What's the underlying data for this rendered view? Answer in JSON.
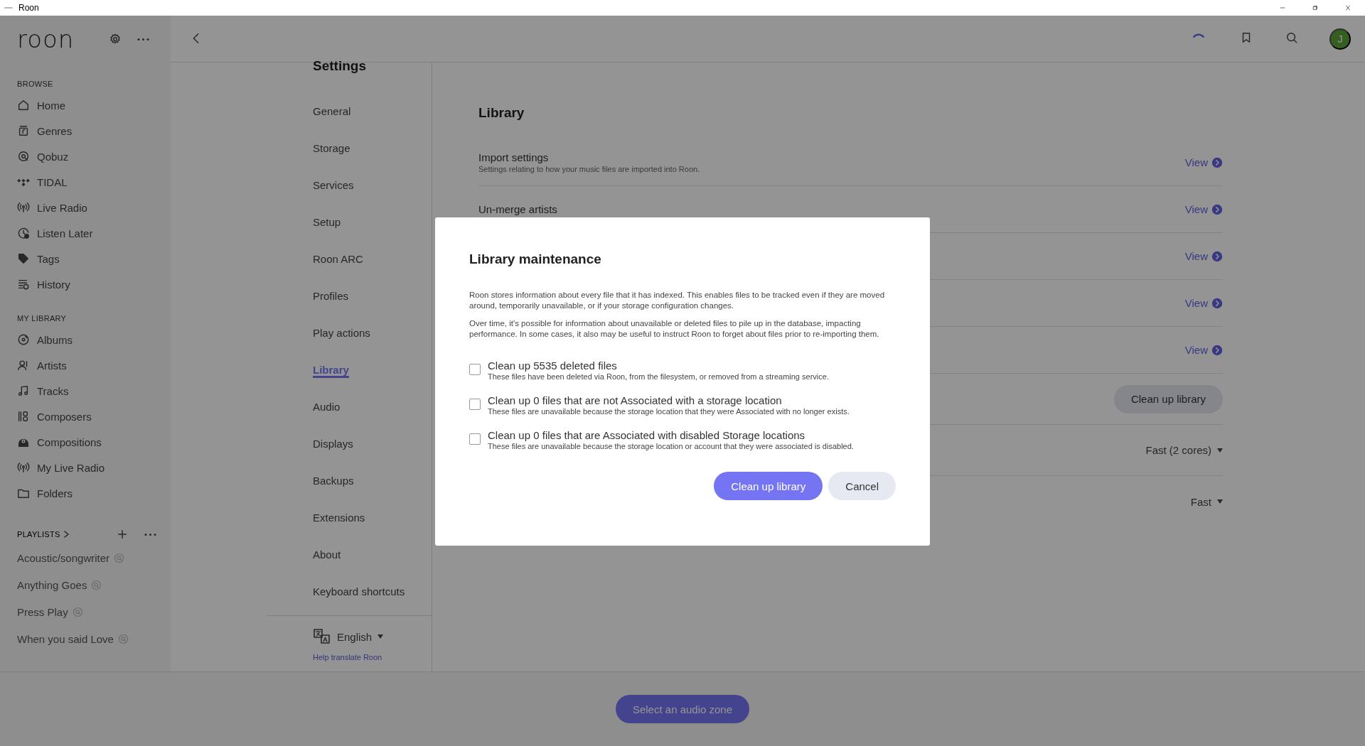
{
  "window": {
    "title": "Roon"
  },
  "sidebar": {
    "logo": "roon",
    "sections": [
      {
        "heading": "BROWSE",
        "items": [
          {
            "label": "Home"
          },
          {
            "label": "Genres"
          },
          {
            "label": "Qobuz"
          },
          {
            "label": "TIDAL"
          },
          {
            "label": "Live Radio"
          },
          {
            "label": "Listen Later"
          },
          {
            "label": "Tags"
          },
          {
            "label": "History"
          }
        ]
      },
      {
        "heading": "MY LIBRARY",
        "items": [
          {
            "label": "Albums"
          },
          {
            "label": "Artists"
          },
          {
            "label": "Tracks"
          },
          {
            "label": "Composers"
          },
          {
            "label": "Compositions"
          },
          {
            "label": "My Live Radio"
          },
          {
            "label": "Folders"
          }
        ]
      }
    ],
    "playlists": {
      "heading": "PLAYLISTS",
      "items": [
        {
          "label": "Acoustic/songwriter"
        },
        {
          "label": "Anything Goes"
        },
        {
          "label": "Press Play"
        },
        {
          "label": "When you said Love"
        }
      ]
    }
  },
  "header": {
    "avatar": "J"
  },
  "settings_nav": {
    "title": "Settings",
    "items": [
      {
        "label": "General",
        "selected": false
      },
      {
        "label": "Storage",
        "selected": false
      },
      {
        "label": "Services",
        "selected": false
      },
      {
        "label": "Setup",
        "selected": false
      },
      {
        "label": "Roon ARC",
        "selected": false
      },
      {
        "label": "Profiles",
        "selected": false
      },
      {
        "label": "Play actions",
        "selected": false
      },
      {
        "label": "Library",
        "selected": true
      },
      {
        "label": "Audio",
        "selected": false
      },
      {
        "label": "Displays",
        "selected": false
      },
      {
        "label": "Backups",
        "selected": false
      },
      {
        "label": "Extensions",
        "selected": false
      },
      {
        "label": "About",
        "selected": false
      },
      {
        "label": "Keyboard shortcuts",
        "selected": false
      }
    ],
    "language": "English",
    "help_link": "Help translate Roon"
  },
  "library": {
    "title": "Library",
    "rows": [
      {
        "kind": "view",
        "label": "Import settings",
        "description": "Settings relating to how your music files are imported into Roon.",
        "action": "View"
      },
      {
        "kind": "view",
        "label": "Un-merge artists",
        "action": "View"
      },
      {
        "kind": "view",
        "action": "View"
      },
      {
        "kind": "view",
        "action": "View"
      },
      {
        "kind": "view",
        "action": "View"
      },
      {
        "kind": "button",
        "action": "Clean up library"
      },
      {
        "kind": "select",
        "action": "Fast (2 cores)"
      },
      {
        "kind": "select",
        "action": "Fast"
      }
    ]
  },
  "dialog": {
    "title": "Library maintenance",
    "paragraphs": [
      "Roon stores information about every file that it has indexed. This enables files to be tracked even if they are moved around, temporarily unavailable, or if your storage configuration changes.",
      "Over time, it's possible for information about unavailable or deleted files to pile up in the database, impacting performance. In some cases, it also may be useful to instruct Roon to forget about files prior to re-importing them."
    ],
    "options": [
      {
        "label": "Clean up 5535 deleted files",
        "description": "These files have been deleted via Roon, from the filesystem, or removed from a streaming service.",
        "checked": false
      },
      {
        "label": "Clean up 0 files that are not Associated with a storage location",
        "description": "These files are unavailable because the storage location that they were Associated with no longer exists.",
        "checked": false
      },
      {
        "label": "Clean up 0 files that are Associated with disabled Storage locations",
        "description": "These files are unavailable because the storage location or account that they were associated is disabled.",
        "checked": false
      }
    ],
    "buttons": [
      {
        "label": "Clean up library",
        "kind": "primary"
      },
      {
        "label": "Cancel",
        "kind": "secondary"
      }
    ]
  },
  "footer": {
    "zone_button": "Select an audio zone"
  }
}
